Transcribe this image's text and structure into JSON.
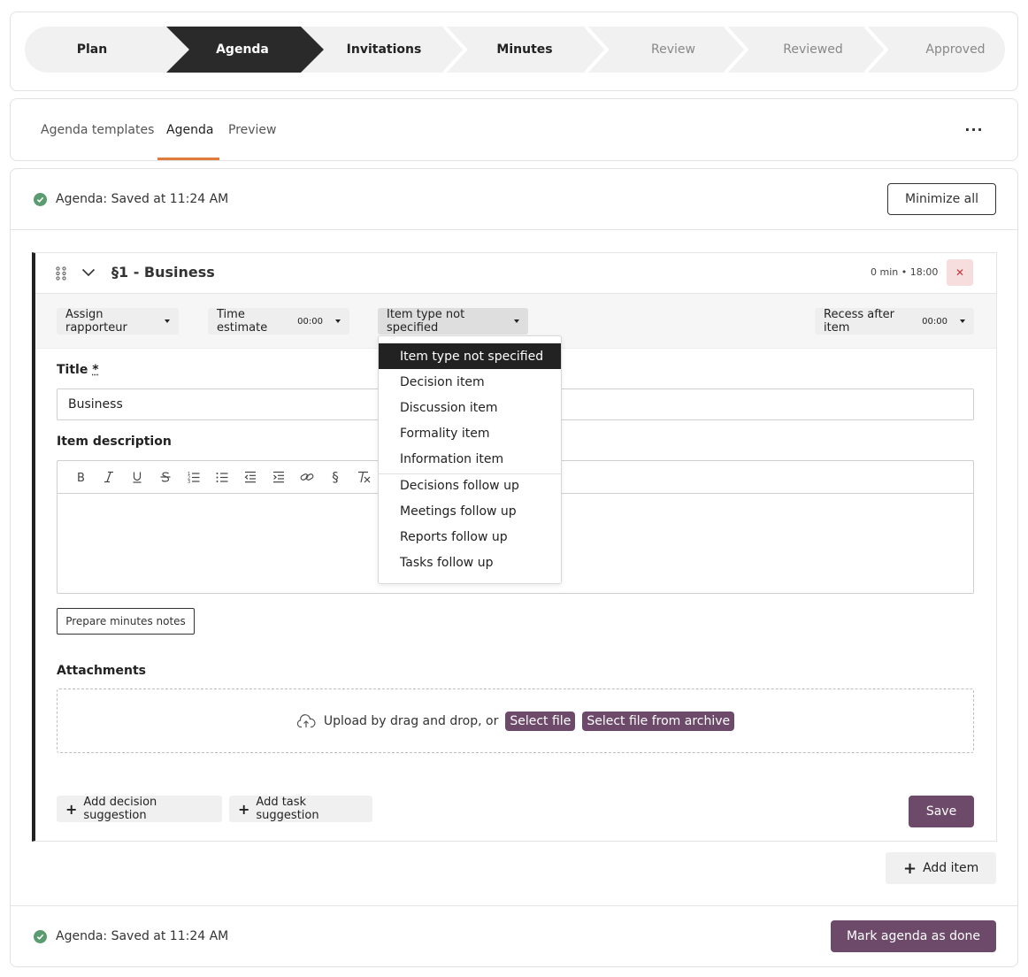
{
  "stepper": {
    "steps": [
      {
        "label": "Plan",
        "state": "done"
      },
      {
        "label": "Agenda",
        "state": "active"
      },
      {
        "label": "Invitations",
        "state": "done"
      },
      {
        "label": "Minutes",
        "state": "done"
      },
      {
        "label": "Review",
        "state": "future"
      },
      {
        "label": "Reviewed",
        "state": "future"
      },
      {
        "label": "Approved",
        "state": "future"
      }
    ]
  },
  "tabs": {
    "items": [
      {
        "label": "Agenda templates"
      },
      {
        "label": "Agenda",
        "active": true
      },
      {
        "label": "Preview"
      }
    ],
    "more_label": "···"
  },
  "status": {
    "top_text": "Agenda: Saved at 11:24 AM",
    "bottom_text": "Agenda: Saved at 11:24 AM"
  },
  "actions": {
    "minimize_all": "Minimize all",
    "add_item": "Add item",
    "mark_done": "Mark agenda as done"
  },
  "item": {
    "title": "§1 - Business",
    "meta": "0 min • 18:00",
    "close_glyph": "✕",
    "toolbar": {
      "assign_rapporteur": "Assign rapporteur",
      "time_estimate_label": "Time estimate",
      "time_estimate_value": "00:00",
      "item_type": "Item type not specified",
      "recess_label": "Recess after item",
      "recess_value": "00:00"
    },
    "title_label": "Title",
    "title_required": "*",
    "title_value": "Business",
    "description_label": "Item description",
    "editor_buttons": [
      "B",
      "I",
      "U",
      "S",
      "ol",
      "ul",
      "outdent",
      "indent",
      "link",
      "§",
      "clear"
    ],
    "prepare_minutes": "Prepare minutes notes",
    "attachments_label": "Attachments",
    "upload_text": "Upload by drag and drop, or",
    "select_file": "Select file",
    "select_archive": "Select file from archive",
    "add_decision": "Add decision suggestion",
    "add_task": "Add task suggestion",
    "save": "Save"
  },
  "item_type_dropdown": {
    "options": [
      {
        "label": "Item type not specified",
        "selected": true
      },
      {
        "label": "Decision item"
      },
      {
        "label": "Discussion item"
      },
      {
        "label": "Formality item"
      },
      {
        "label": "Information item"
      },
      {
        "label": "Decisions follow up"
      },
      {
        "label": "Meetings follow up"
      },
      {
        "label": "Reports follow up"
      },
      {
        "label": "Tasks follow up"
      }
    ]
  },
  "colors": {
    "accent_underline": "#e07b3c",
    "primary_purple": "#6e4a6a",
    "success_green": "#5a9b6f",
    "active_step": "#2a2a2a"
  }
}
